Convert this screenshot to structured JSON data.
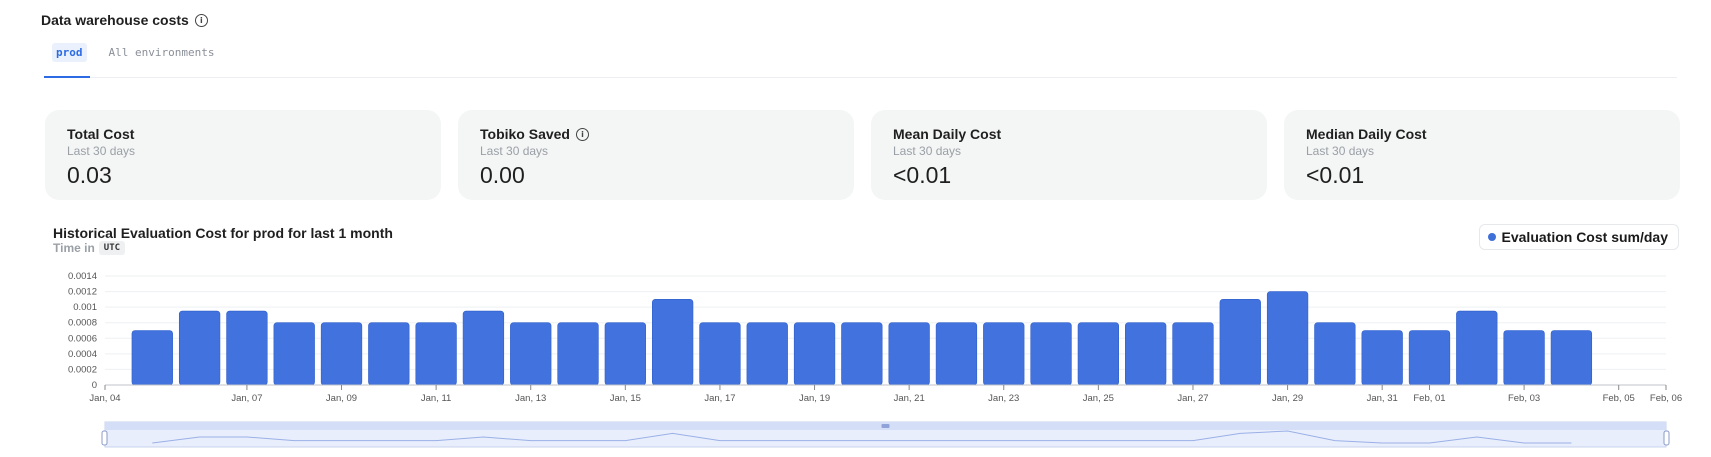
{
  "header": {
    "title": "Data warehouse costs",
    "info_icon": "info-icon"
  },
  "tabs": [
    {
      "label": "prod",
      "active": true
    },
    {
      "label": "All environments",
      "active": false
    }
  ],
  "cards": [
    {
      "label": "Total Cost",
      "sub": "Last 30 days",
      "value": "0.03",
      "info": false
    },
    {
      "label": "Tobiko Saved",
      "sub": "Last 30 days",
      "value": "0.00",
      "info": true
    },
    {
      "label": "Mean Daily Cost",
      "sub": "Last 30 days",
      "value": "<0.01",
      "info": false
    },
    {
      "label": "Median Daily Cost",
      "sub": "Last 30 days",
      "value": "<0.01",
      "info": false
    }
  ],
  "chart": {
    "title": "Historical Evaluation Cost for prod for last 1 month",
    "time_in_label": "Time in",
    "timezone": "UTC",
    "legend": "Evaluation Cost sum/day"
  },
  "colors": {
    "accent": "#2d6be4",
    "bar": "#4272dd"
  },
  "chart_data": {
    "type": "bar",
    "x_dates": [
      "Jan, 05",
      "Jan, 06",
      "Jan, 07",
      "Jan, 08",
      "Jan, 09",
      "Jan, 10",
      "Jan, 11",
      "Jan, 12",
      "Jan, 13",
      "Jan, 14",
      "Jan, 15",
      "Jan, 16",
      "Jan, 17",
      "Jan, 18",
      "Jan, 19",
      "Jan, 20",
      "Jan, 21",
      "Jan, 22",
      "Jan, 23",
      "Jan, 24",
      "Jan, 25",
      "Jan, 26",
      "Jan, 27",
      "Jan, 28",
      "Jan, 29",
      "Jan, 30",
      "Jan, 31",
      "Feb, 01",
      "Feb, 02",
      "Feb, 03",
      "Feb, 04",
      "Feb, 05"
    ],
    "values": [
      0.0007,
      0.00095,
      0.00095,
      0.0008,
      0.0008,
      0.0008,
      0.0008,
      0.00095,
      0.0008,
      0.0008,
      0.0008,
      0.0011,
      0.0008,
      0.0008,
      0.0008,
      0.0008,
      0.0008,
      0.0008,
      0.0008,
      0.0008,
      0.0008,
      0.0008,
      0.0008,
      0.0011,
      0.0012,
      0.0008,
      0.0007,
      0.0007,
      0.00095,
      0.0007,
      0.0007
    ],
    "x_tick_labels": [
      "Jan, 04",
      "Jan, 07",
      "Jan, 09",
      "Jan, 11",
      "Jan, 13",
      "Jan, 15",
      "Jan, 17",
      "Jan, 19",
      "Jan, 21",
      "Jan, 23",
      "Jan, 25",
      "Jan, 27",
      "Jan, 29",
      "Jan, 31",
      "Feb, 01",
      "Feb, 03",
      "Feb, 05",
      "Feb, 06"
    ],
    "y_ticks": [
      "0",
      "0.0002",
      "0.0004",
      "0.0006",
      "0.0008",
      "0.001",
      "0.0012",
      "0.0014"
    ],
    "ylim": [
      0,
      0.0014
    ],
    "grid": true,
    "legend_position": "top-right"
  }
}
